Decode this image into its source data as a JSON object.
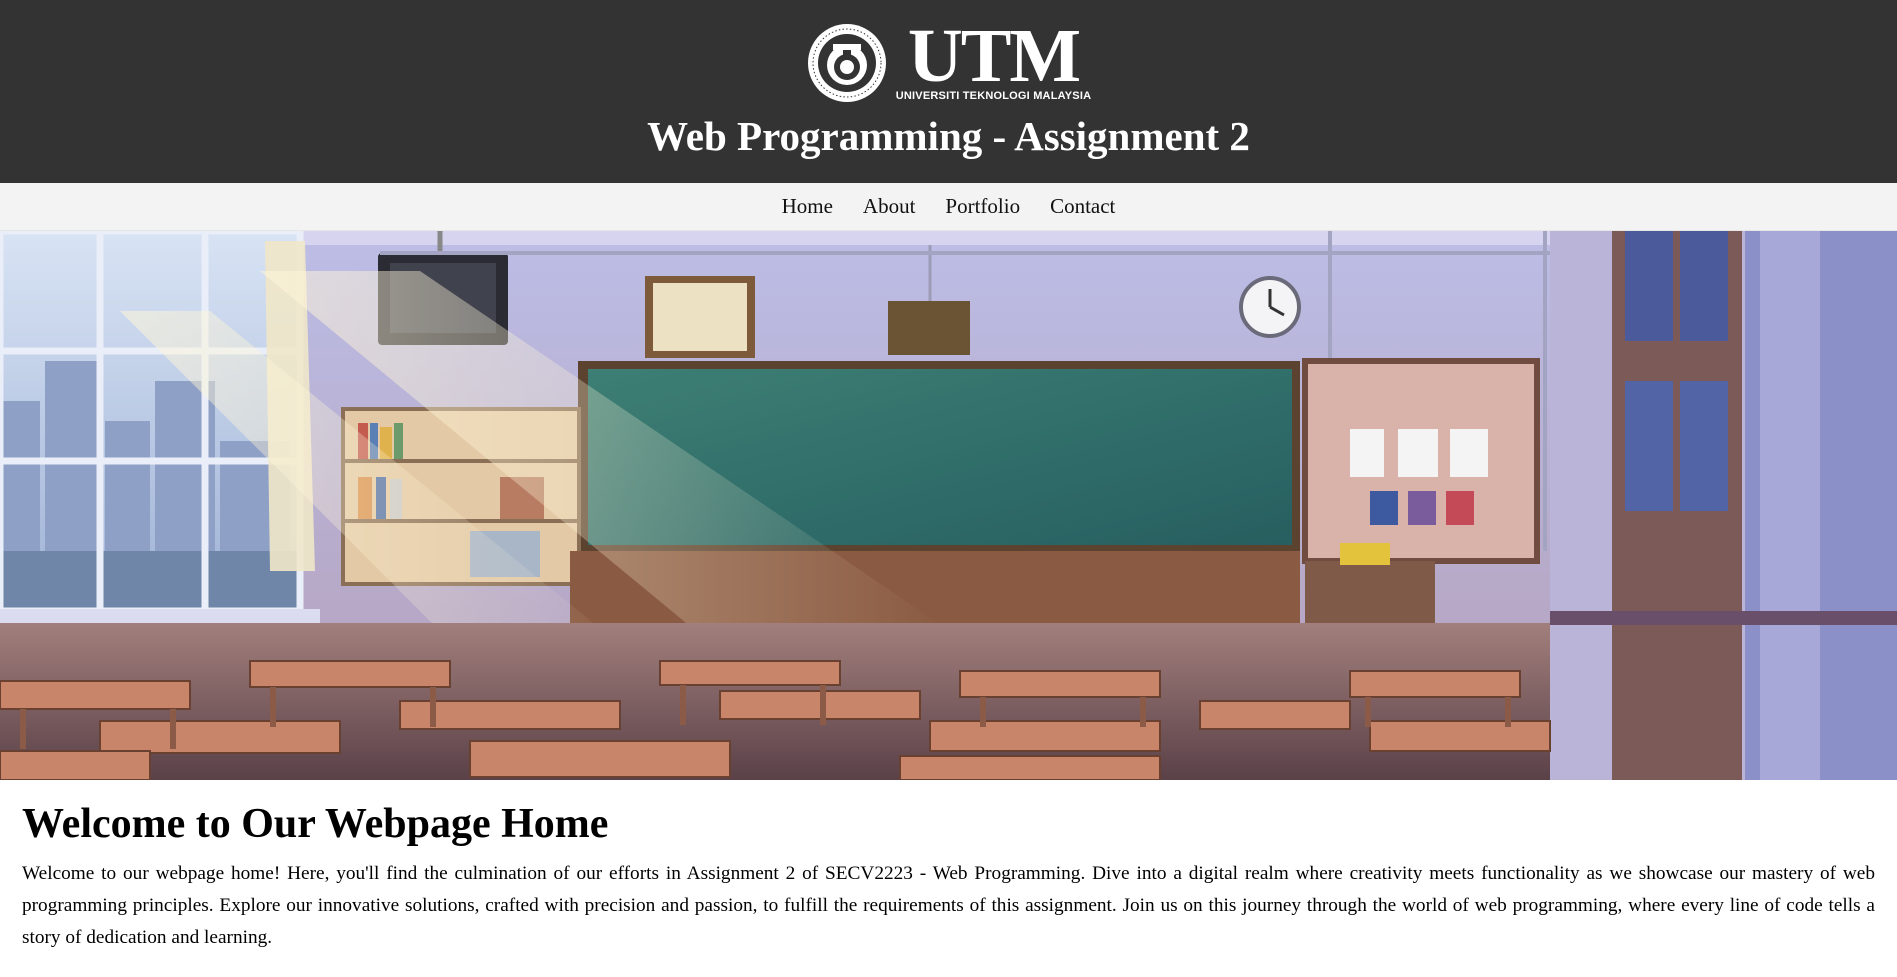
{
  "header": {
    "logo": {
      "wordmark": "UTM",
      "subtitle": "UNIVERSITI TEKNOLOGI MALAYSIA",
      "seal_text": "KERANA TUHAN UNTUK MANUSIA • UNIVERSITI TEKNOLOGI MALAYSIA"
    },
    "title": "Web Programming - Assignment 2"
  },
  "nav": {
    "items": [
      {
        "label": "Home"
      },
      {
        "label": "About"
      },
      {
        "label": "Portfolio"
      },
      {
        "label": "Contact"
      }
    ]
  },
  "hero": {
    "image": "anime-classroom-illustration"
  },
  "main": {
    "heading": "Welcome to Our Webpage Home",
    "body": "Welcome to our webpage home! Here, you'll find the culmination of our efforts in Assignment 2 of SECV2223 - Web Programming. Dive into a digital realm where creativity meets functionality as we showcase our mastery of web programming principles. Explore our innovative solutions, crafted with precision and passion, to fulfill the requirements of this assignment. Join us on this journey through the world of web programming, where every line of code tells a story of dedication and learning."
  },
  "colors": {
    "header_bg": "#333333",
    "nav_bg": "#f3f3f3",
    "text": "#000000",
    "header_text": "#ffffff"
  }
}
